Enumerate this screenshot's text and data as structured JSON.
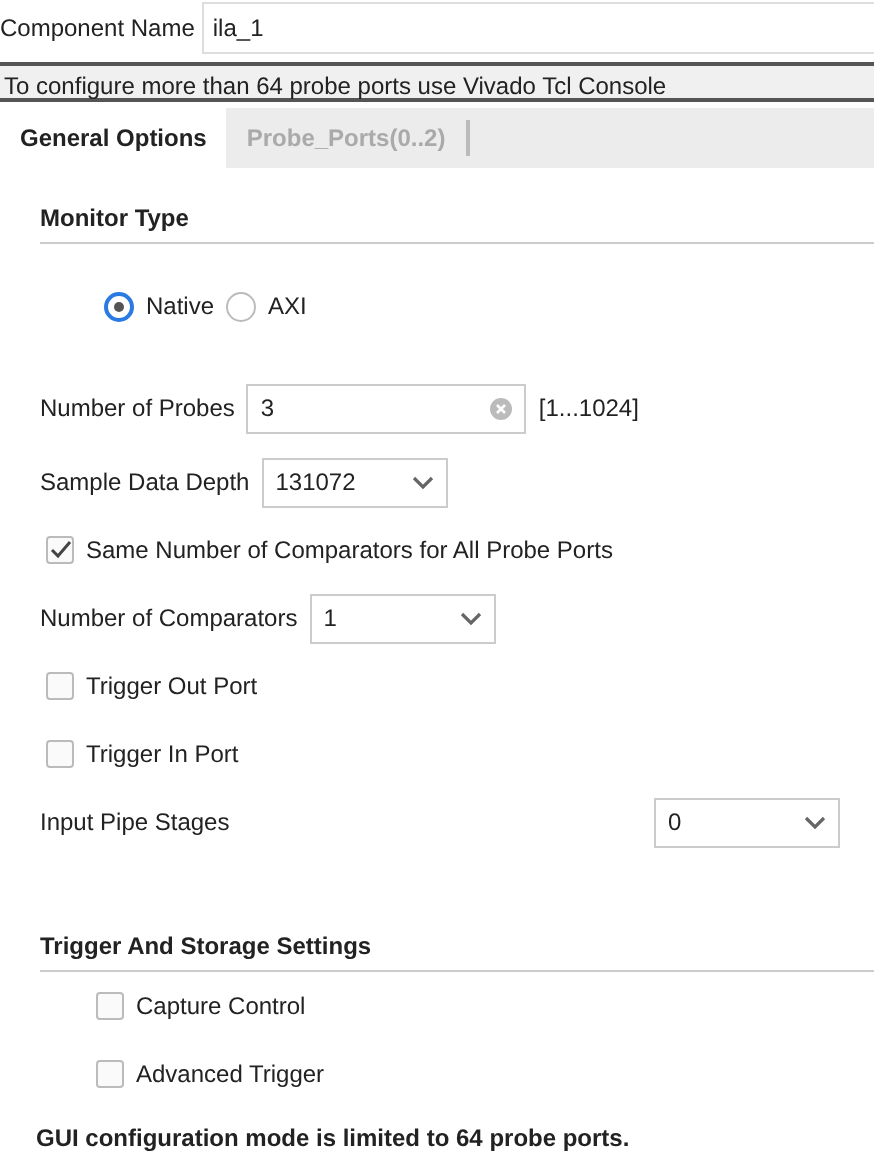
{
  "component_name": {
    "label": "Component Name",
    "value": "ila_1"
  },
  "banner": "To configure more than 64 probe ports use Vivado Tcl Console",
  "tabs": [
    {
      "label": "General Options",
      "selected": true
    },
    {
      "label": "Probe_Ports(0..2)",
      "selected": false
    }
  ],
  "sections": [
    {
      "title": "Monitor Type",
      "rows": [
        {
          "kind": "radios",
          "options": [
            {
              "label": "Native",
              "selected": true
            },
            {
              "label": "AXI",
              "selected": false
            }
          ]
        },
        {
          "kind": "text",
          "label": "Number of Probes",
          "value": "3",
          "range": "[1...1024]"
        },
        {
          "kind": "select",
          "label": "Sample Data Depth",
          "value": "131072"
        },
        {
          "kind": "checkbox",
          "label": "Same Number of Comparators for All Probe Ports",
          "checked": true
        },
        {
          "kind": "select",
          "label": "Number of Comparators",
          "value": "1"
        },
        {
          "kind": "checkbox",
          "label": "Trigger Out Port",
          "checked": false
        },
        {
          "kind": "checkbox",
          "label": "Trigger In Port",
          "checked": false
        },
        {
          "kind": "wide-select",
          "label": "Input Pipe Stages",
          "value": "0"
        }
      ]
    },
    {
      "title": "Trigger And Storage Settings",
      "rows": [
        {
          "kind": "sub-checkbox",
          "label": "Capture Control",
          "checked": false
        },
        {
          "kind": "sub-checkbox",
          "label": "Advanced Trigger",
          "checked": false
        }
      ]
    }
  ],
  "footer": "GUI configuration mode is limited to 64 probe ports."
}
